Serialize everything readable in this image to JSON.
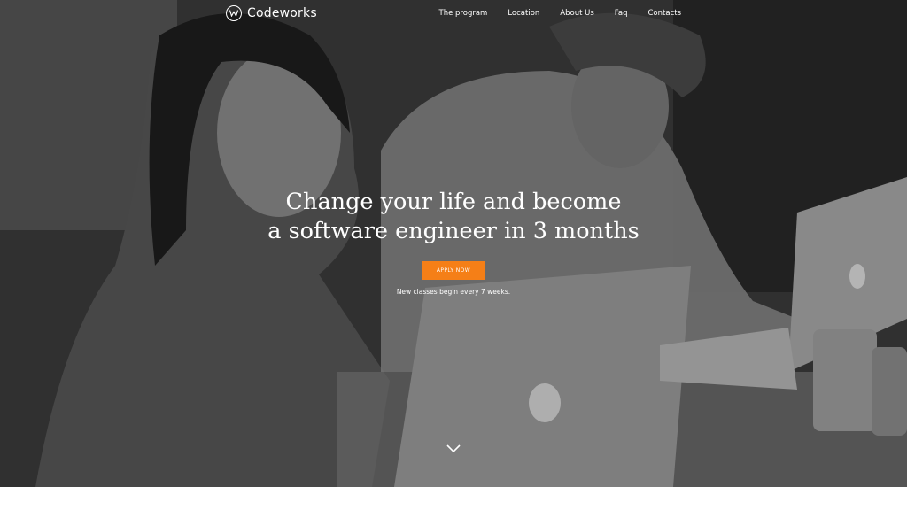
{
  "brand": {
    "name": "Codeworks",
    "logo_icon": "w-circle-icon"
  },
  "nav": {
    "items": [
      {
        "label": "The program"
      },
      {
        "label": "Location"
      },
      {
        "label": "About Us"
      },
      {
        "label": "Faq"
      },
      {
        "label": "Contacts"
      }
    ]
  },
  "hero": {
    "headline_line1": "Change your life and become",
    "headline_line2": "a software engineer in 3 months",
    "cta_label": "APPLY NOW",
    "subtext": "New classes begin every 7 weeks.",
    "scroll_icon": "chevron-down-icon"
  },
  "colors": {
    "accent": "#f57f17",
    "text": "#ffffff",
    "overlay": "#3a3a3a"
  }
}
